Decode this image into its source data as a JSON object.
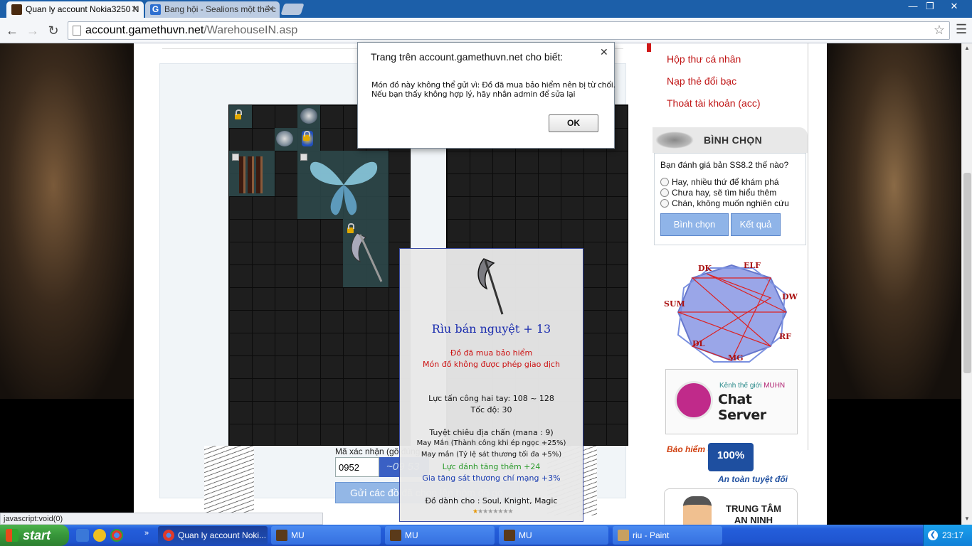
{
  "browser": {
    "tabs": [
      {
        "title": "Quan ly account Nokia3250 N",
        "active": true
      },
      {
        "title": "Bang hội - Sealions một thế c",
        "active": false
      }
    ],
    "url_host": "account.gamethuvn.net",
    "url_path": "/WarehouseIN.asp",
    "status": "javascript:void(0)"
  },
  "page": {
    "captcha_label": "Mã xác nhận (gõ đúng ...)",
    "captcha_value": "0952",
    "captcha_image_text": "~09 53",
    "send_button": "Gửi các đồ đã chọn lên hòm đồ gó",
    "tooltip": {
      "item_name": "Rìu bán nguyệt + 13",
      "lines": [
        {
          "text": "Đồ đã mua bảo hiểm",
          "color": "red"
        },
        {
          "text": "Món đồ không được phép giao dịch",
          "color": "red"
        },
        {
          "text": "Lực tấn công hai tay: 108 ~ 128",
          "color": "dark"
        },
        {
          "text": "Tốc độ: 30",
          "color": "dark"
        },
        {
          "text": "Tuyệt chiêu địa chấn (mana : 9)",
          "color": "dark"
        },
        {
          "text": "May Mắn (Thành công khi ép ngọc +25%)",
          "color": "dark"
        },
        {
          "text": "May mắn (Tỷ lệ sát thương tối đa +5%)",
          "color": "dark"
        },
        {
          "text": "Lực đánh tăng thêm +24",
          "color": "green"
        },
        {
          "text": "Gia tăng sát thương chí mạng +3%",
          "color": "blue"
        },
        {
          "text": "Đồ dành cho : Soul, Knight, Magic",
          "color": "dark"
        }
      ],
      "stars_filled": 1,
      "stars_total": 8
    }
  },
  "sidebar": {
    "links": [
      "Hộp thư cá nhân",
      "Nạp thẻ đổi bạc",
      "Thoát tài khoản (acc)"
    ],
    "vote": {
      "title": "BÌNH CHỌN",
      "question": "Bạn đánh giá bản SS8.2 thế nào?",
      "options": [
        "Hay, nhiều thứ để khám phá",
        "Chưa hay, sẽ tìm hiểu thêm",
        "Chán, không muốn nghiên cứu"
      ],
      "vote_button": "Bình chọn",
      "result_button": "Kết quả"
    },
    "classes": [
      "DK",
      "ELF",
      "DW",
      "RF",
      "MG",
      "DL",
      "SUM"
    ],
    "chat": {
      "kenh": "Kênh thế giới",
      "brand": "MUHN",
      "title": "Chat Server"
    },
    "insurance": {
      "top": "Bảo hiểm đồ",
      "seal": "100%",
      "bottom": "An toàn tuyệt đối"
    },
    "security": {
      "line1": "TRUNG TÂM",
      "line2": "AN NINH"
    }
  },
  "dialog": {
    "title": "Trang trên account.gamethuvn.net cho biết:",
    "message_line1": "Món đồ này không thể gửi vì: Đồ đã mua bảo hiểm nên bị từ chối.",
    "message_line2": "Nếu bạn thấy không hợp lý, hãy nhắn admin để sửa lại",
    "ok": "OK"
  },
  "taskbar": {
    "start": "start",
    "tasks": [
      {
        "label": "Quan ly account Noki...",
        "active": true
      },
      {
        "label": "MU",
        "active": false
      },
      {
        "label": "MU",
        "active": false
      },
      {
        "label": "MU",
        "active": false
      },
      {
        "label": "riu - Paint",
        "active": false
      }
    ],
    "clock": "23:17"
  }
}
